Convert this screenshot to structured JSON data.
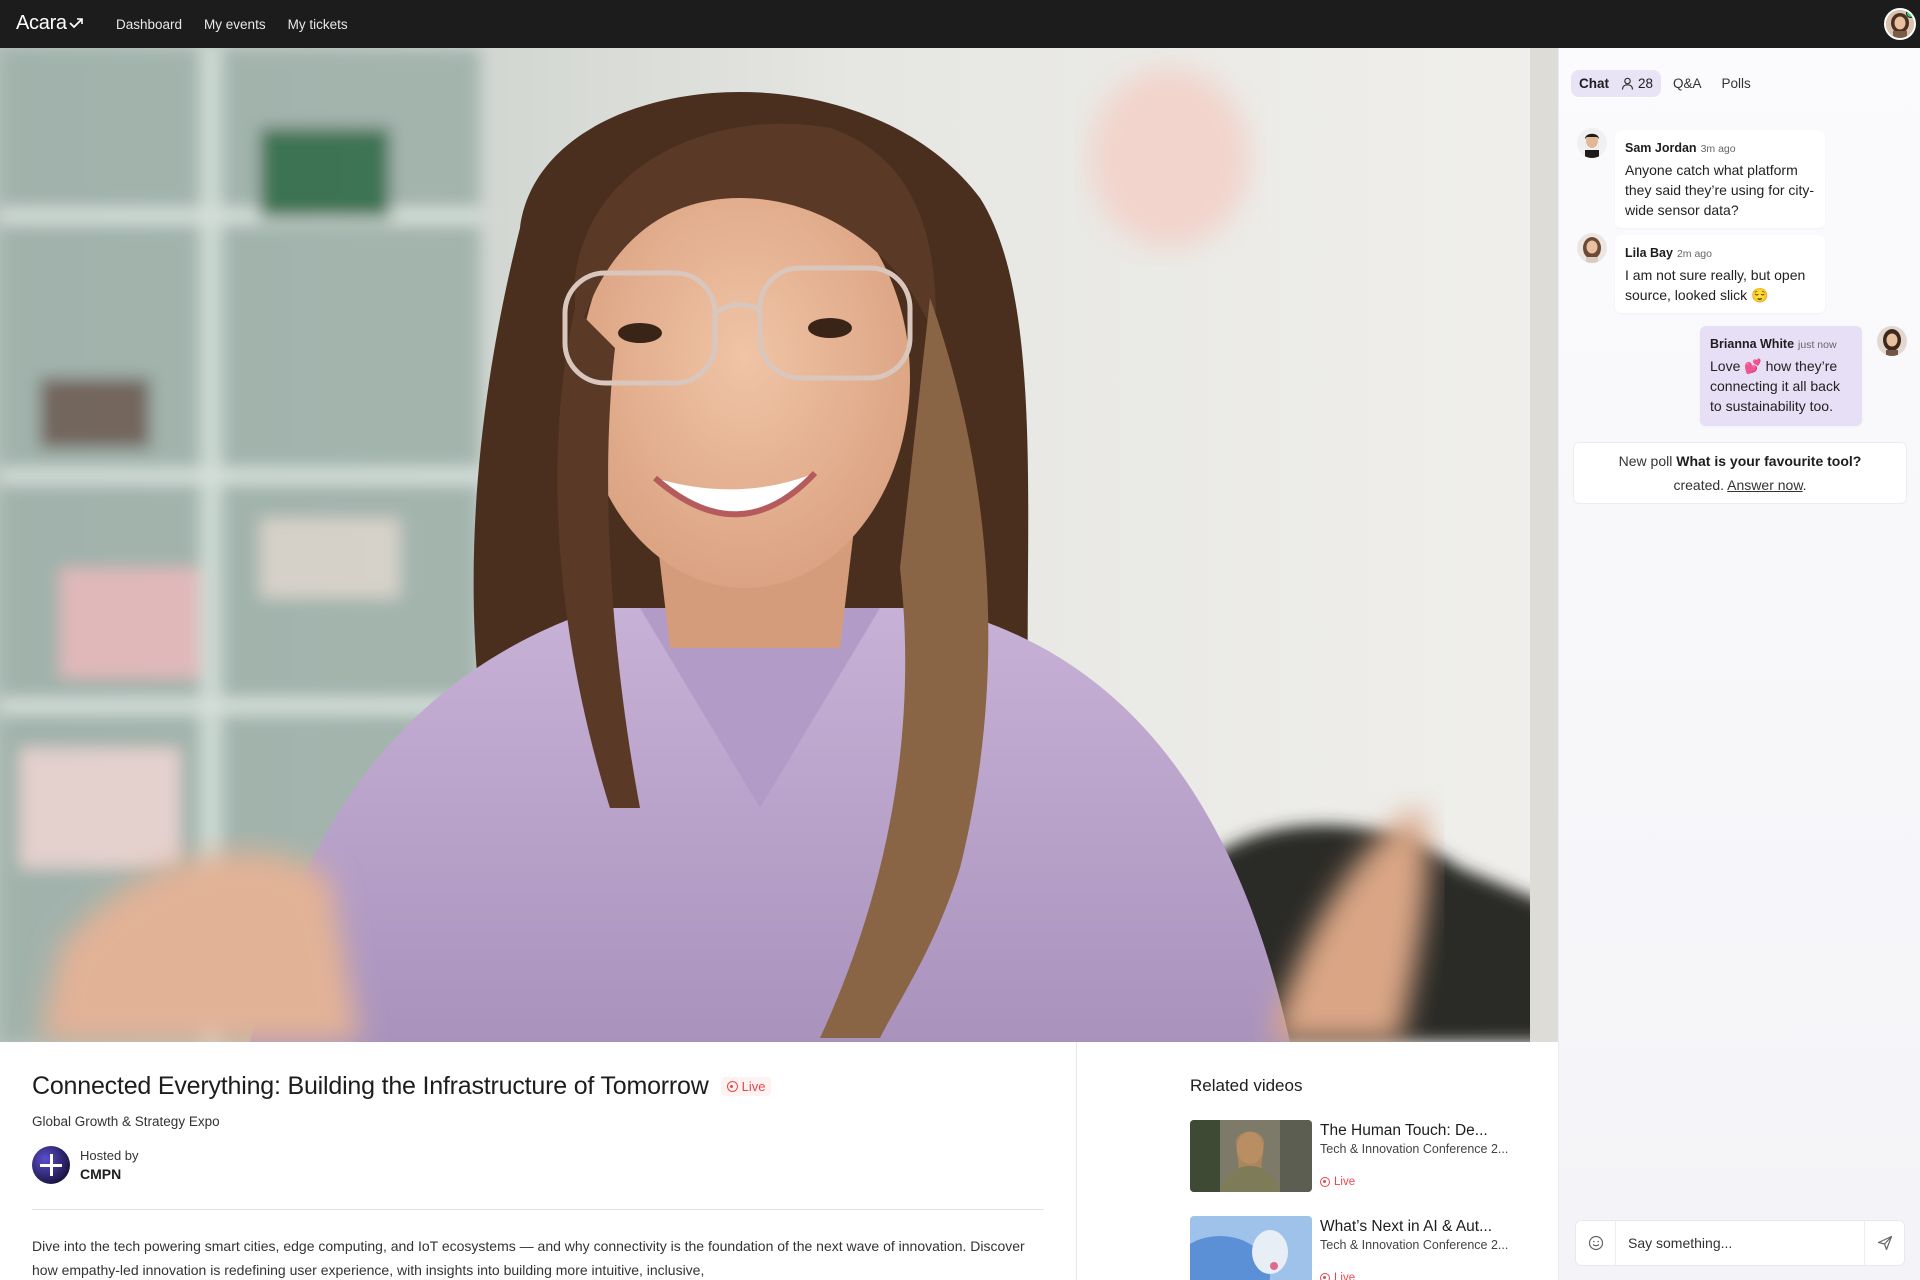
{
  "app": {
    "logo_text": "Acara",
    "colors": {
      "topbar": "#1c1c1c",
      "live": "#e5484d",
      "accent_tab": "#e9e3f6",
      "mine_bubble": "#e6dff5",
      "online": "#35c46a"
    }
  },
  "nav": {
    "items": [
      {
        "label": "Dashboard"
      },
      {
        "label": "My events"
      },
      {
        "label": "My tickets"
      }
    ],
    "avatar_icon": "user-avatar"
  },
  "video": {
    "subject": "woman-with-glasses-speaking"
  },
  "event": {
    "title": "Connected Everything: Building the Infrastructure of Tomorrow",
    "live_label": "Live",
    "subtitle": "Global Growth & Strategy Expo",
    "hosted_by_label": "Hosted by",
    "host_name": "CMPN",
    "description": "Dive into the tech powering smart cities, edge computing, and IoT ecosystems — and why connectivity is the foundation of the next wave of innovation. Discover how empathy-led innovation is redefining user experience, with insights into building more intuitive, inclusive,"
  },
  "related": {
    "heading": "Related videos",
    "items": [
      {
        "title": "The Human Touch: De...",
        "subtitle": "Tech & Innovation Conference 2...",
        "live_label": "Live"
      },
      {
        "title": "What’s Next in AI & Aut...",
        "subtitle": "Tech & Innovation Conference 2...",
        "live_label": "Live"
      }
    ]
  },
  "chat": {
    "tabs": [
      {
        "label": "Chat",
        "count": "28"
      },
      {
        "label": "Q&A"
      },
      {
        "label": "Polls"
      }
    ],
    "messages": [
      {
        "name": "Sam Jordan",
        "time": "3m ago",
        "text": "Anyone catch what platform they said they’re using for city-wide sensor data?"
      },
      {
        "name": "Lila Bay",
        "time": "2m ago",
        "text": "I am not sure really, but open source, looked slick 😌"
      },
      {
        "name": "Brianna White",
        "time": "just now",
        "text": "Love 💕 how they’re connecting it all back to sustainability too."
      }
    ],
    "poll": {
      "prefix": "New poll",
      "question": "What is your favourite tool?",
      "mid": "created.",
      "answer_link": "Answer now",
      "suffix": "."
    },
    "composer": {
      "placeholder": "Say something..."
    }
  }
}
